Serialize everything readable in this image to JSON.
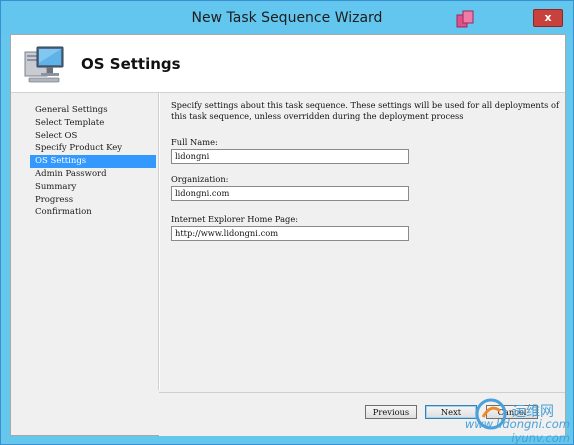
{
  "window": {
    "title": "New Task Sequence Wizard",
    "close_label": "x"
  },
  "header": {
    "title": "OS Settings",
    "icon": "computer-icon"
  },
  "nav": {
    "items": [
      {
        "label": "General Settings"
      },
      {
        "label": "Select Template"
      },
      {
        "label": "Select OS"
      },
      {
        "label": "Specify Product Key"
      },
      {
        "label": "OS Settings",
        "active": true
      },
      {
        "label": "Admin Password"
      },
      {
        "label": "Summary"
      },
      {
        "label": "Progress"
      },
      {
        "label": "Confirmation"
      }
    ]
  },
  "content": {
    "description": "Specify settings about this task sequence.  These settings will be used for all deployments of this task sequence, unless overridden during the deployment process",
    "full_name": {
      "label": "Full Name:",
      "value": "lidongni"
    },
    "organization": {
      "label": "Organization:",
      "value": "lidongni.com"
    },
    "home_page": {
      "label": "Internet Explorer Home Page:",
      "value": "http://www.lidongni.com"
    }
  },
  "footer": {
    "previous": "Previous",
    "next": "Next",
    "cancel": "Cancel"
  },
  "watermark": {
    "cn": "运维网",
    "url": "www.lidongni.com",
    "url2": "iyunv.com"
  },
  "colors": {
    "titlebar": "#63c6ee",
    "selection": "#3399ff",
    "close": "#c9413d"
  }
}
